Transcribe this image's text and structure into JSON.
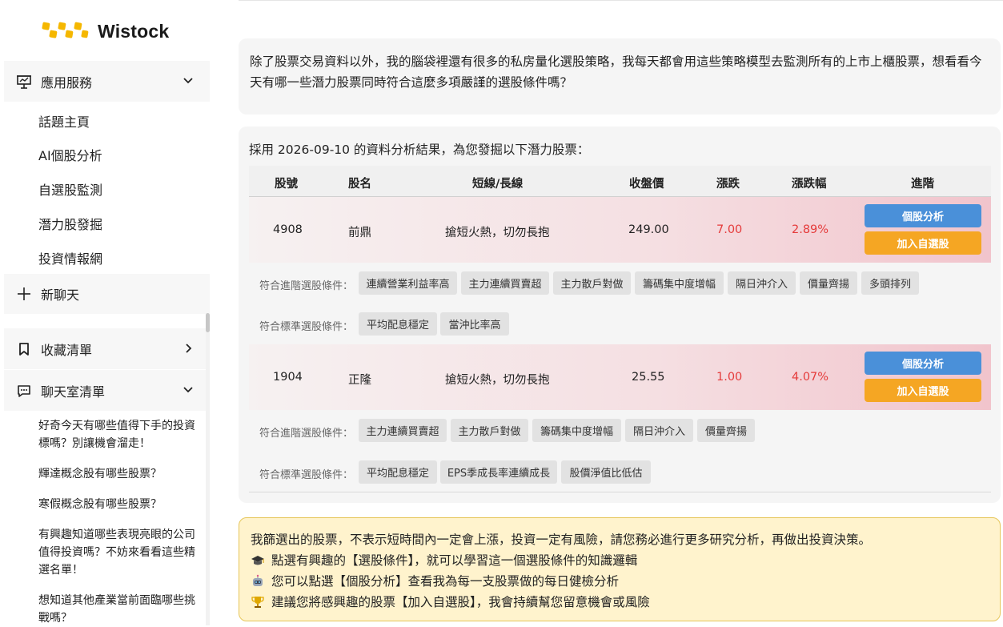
{
  "brand": {
    "name": "Wistock"
  },
  "sidebar": {
    "services": {
      "label": "應用服務",
      "icon": "presentation-icon"
    },
    "service_items": [
      {
        "label": "話題主頁"
      },
      {
        "label": "AI個股分析"
      },
      {
        "label": "自選股監測"
      },
      {
        "label": "潛力股發掘"
      },
      {
        "label": "投資情報網"
      }
    ],
    "new_chat": {
      "label": "新聊天",
      "icon": "plus-icon"
    },
    "favorites": {
      "label": "收藏清單",
      "icon": "bookmark-icon"
    },
    "chatrooms": {
      "label": "聊天室清單",
      "icon": "chat-bubble-icon"
    },
    "chat_items": [
      {
        "label": "好奇今天有哪些值得下手的投資標嗎？別讓機會溜走！"
      },
      {
        "label": "輝達概念股有哪些股票？"
      },
      {
        "label": "寒假概念股有哪些股票？"
      },
      {
        "label": "有興趣知道哪些表現亮眼的公司值得投資嗎？不妨來看看這些精選名單！"
      },
      {
        "label": "想知道其他產業當前面臨哪些挑戰嗎？"
      }
    ]
  },
  "chat": {
    "user_message": "除了股票交易資料以外，我的腦袋裡還有很多的私房量化選股策略，我每天都會用這些策略模型去監測所有的上市上櫃股票，想看看今天有哪一些潛力股票同時符合這麼多項嚴謹的選股條件嗎？",
    "result_intro": "採用 2026-09-10 的資料分析結果，為您發掘以下潛力股票：",
    "table": {
      "headers": {
        "code": "股號",
        "name": "股名",
        "term": "短線/長線",
        "close": "收盤價",
        "change": "漲跌",
        "pct": "漲跌幅",
        "advanced": "進階"
      },
      "rows": [
        {
          "code": "4908",
          "name": "前鼎",
          "term": "搶短火熱，切勿長抱",
          "close": "249.00",
          "change": "7.00",
          "pct": "2.89%",
          "btn_analyze": "個股分析",
          "btn_add": "加入自選股",
          "adv_label": "符合進階選股條件：",
          "adv_tags": [
            "連續營業利益率高",
            "主力連續買賣超",
            "主力散戶對做",
            "籌碼集中度增幅",
            "隔日沖介入",
            "價量齊揚",
            "多頭排列"
          ],
          "std_label": "符合標準選股條件：",
          "std_tags": [
            "平均配息穩定",
            "當沖比率高"
          ]
        },
        {
          "code": "1904",
          "name": "正隆",
          "term": "搶短火熱，切勿長抱",
          "close": "25.55",
          "change": "1.00",
          "pct": "4.07%",
          "btn_analyze": "個股分析",
          "btn_add": "加入自選股",
          "adv_label": "符合進階選股條件：",
          "adv_tags": [
            "主力連續買賣超",
            "主力散戶對做",
            "籌碼集中度增幅",
            "隔日沖介入",
            "價量齊揚"
          ],
          "std_label": "符合標準選股條件：",
          "std_tags": [
            "平均配息穩定",
            "EPS季成長率連續成長",
            "股價淨值比低估"
          ]
        }
      ]
    },
    "notice": {
      "line1": "我篩選出的股票，不表示短時間內一定會上漲，投資一定有風險，請您務必進行更多研究分析，再做出投資決策。",
      "line2": "點選有興趣的【選股條件】，就可以學習這一個選股條件的知識邏輯",
      "line3": "您可以點選【個股分析】查看我為每一支股票做的每日健檢分析",
      "line4": "建議您將感興趣的股票【加入自選股】，我會持續幫您留意機會或風險"
    }
  },
  "colors": {
    "brand_yellow": "#f5b700",
    "up_red": "#e53b3b",
    "btn_blue": "#4a90d9",
    "btn_orange": "#f5a623"
  }
}
